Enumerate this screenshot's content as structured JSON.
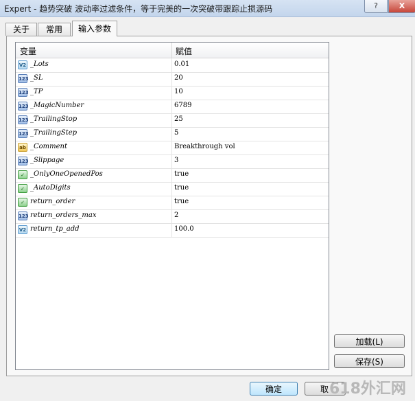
{
  "window": {
    "title": "Expert - 趋势突破 波动率过滤条件，等于完美的一次突破带跟踪止损源码",
    "help_label": "?",
    "close_label": "X"
  },
  "tabs": [
    {
      "label": "关于"
    },
    {
      "label": "常用"
    },
    {
      "label": "输入参数"
    }
  ],
  "grid": {
    "col_variable": "变量",
    "col_value": "赋值",
    "rows": [
      {
        "icon": "V2",
        "type": "dbl",
        "name": "_Lots",
        "value": "0.01"
      },
      {
        "icon": "123",
        "type": "num",
        "name": "_SL",
        "value": "20"
      },
      {
        "icon": "123",
        "type": "num",
        "name": "_TP",
        "value": "10"
      },
      {
        "icon": "123",
        "type": "num",
        "name": "_MagicNumber",
        "value": "6789"
      },
      {
        "icon": "123",
        "type": "num",
        "name": "_TrailingStop",
        "value": "25"
      },
      {
        "icon": "123",
        "type": "num",
        "name": "_TrailingStep",
        "value": "5"
      },
      {
        "icon": "ab",
        "type": "str",
        "name": "_Comment",
        "value": "Breakthrough vol"
      },
      {
        "icon": "123",
        "type": "num",
        "name": "_Slippage",
        "value": "3"
      },
      {
        "icon": "✓",
        "type": "bool",
        "name": "_OnlyOneOpenedPos",
        "value": "true"
      },
      {
        "icon": "✓",
        "type": "bool",
        "name": "_AutoDigits",
        "value": "true"
      },
      {
        "icon": "✓",
        "type": "bool",
        "name": "return_order",
        "value": "true"
      },
      {
        "icon": "123",
        "type": "num",
        "name": "return_orders_max",
        "value": "2"
      },
      {
        "icon": "V2",
        "type": "dbl",
        "name": "return_tp_add",
        "value": "100.0"
      }
    ]
  },
  "buttons": {
    "load": "加载(L)",
    "save": "保存(S)",
    "ok": "确定",
    "cancel": "取"
  },
  "watermark": "618外汇网"
}
